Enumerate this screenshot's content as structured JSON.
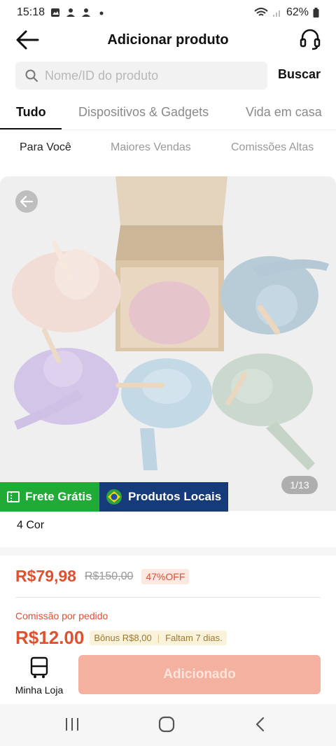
{
  "status_bar": {
    "time": "15:18",
    "battery": "62%"
  },
  "header": {
    "title": "Adicionar produto"
  },
  "search": {
    "placeholder": "Nome/ID do produto",
    "button_label": "Buscar"
  },
  "category_tabs": [
    {
      "label": "Tudo",
      "active": true
    },
    {
      "label": "Dispositivos & Gadgets",
      "active": false
    },
    {
      "label": "Vida em casa",
      "active": false
    }
  ],
  "sub_tabs": [
    {
      "label": "Para Você",
      "active": true
    },
    {
      "label": "Maiores Vendas",
      "active": false
    },
    {
      "label": "Comissões Altas",
      "active": false
    }
  ],
  "product": {
    "image_counter": "1/13",
    "badges": {
      "free_shipping": "Frete Grátis",
      "local_products": "Produtos Locais"
    },
    "variants": "4 Cor",
    "price": "R$79,98",
    "original_price": "R$150,00",
    "discount": "47%OFF",
    "commission_label": "Comissão por pedido",
    "commission_value": "R$12.00",
    "bonus": "Bônus R$8,00",
    "days_left": "Faltam 7 dias."
  },
  "bottom_bar": {
    "store_label": "Minha Loja",
    "add_button_label": "Adicionado"
  },
  "colors": {
    "accent": "#e0502f",
    "free_shipping_green": "#1fab35",
    "local_blue": "#153b7a",
    "button_disabled": "#f5b19f"
  }
}
